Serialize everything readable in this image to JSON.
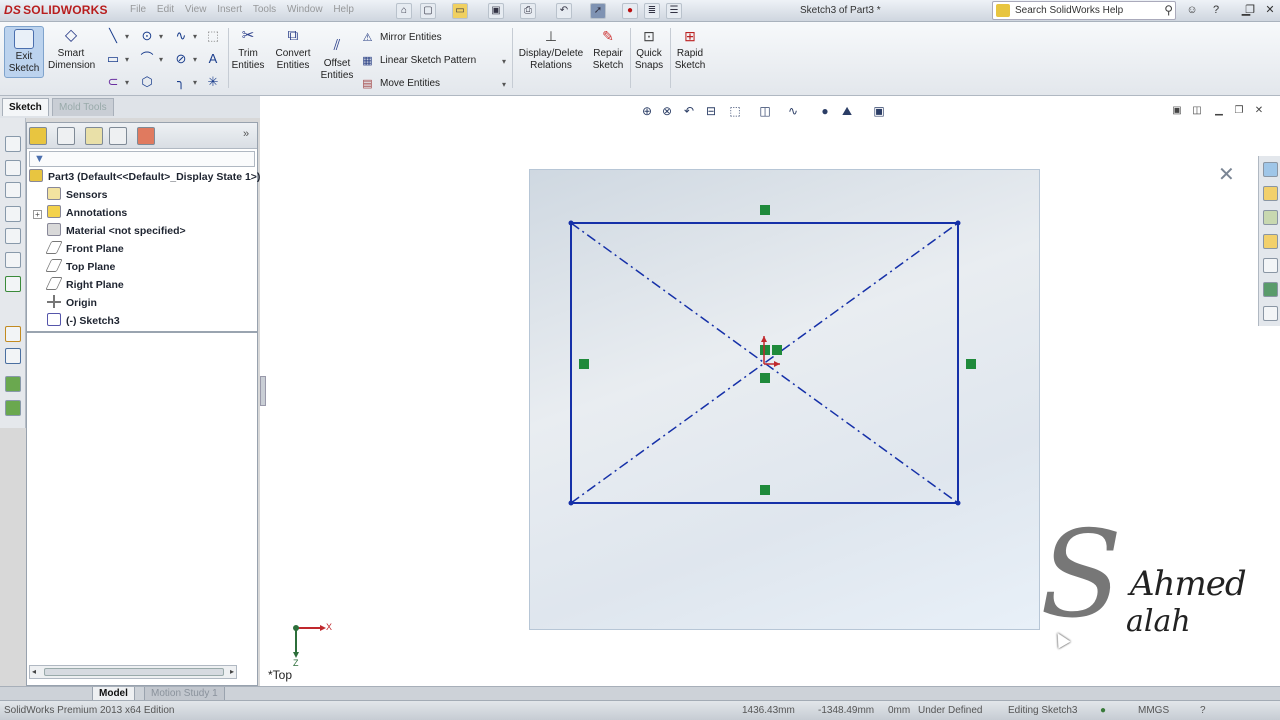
{
  "titlebar": {
    "app_name": "SOLIDWORKS",
    "menu": [
      "File",
      "Edit",
      "View",
      "Insert",
      "Tools",
      "Window",
      "Help"
    ],
    "document_title": "Sketch3 of Part3 *",
    "search_placeholder": "Search SolidWorks Help"
  },
  "ribbon": {
    "exit_sketch": "Exit Sketch",
    "smart_dimension": "Smart Dimension",
    "trim_entities": "Trim Entities",
    "convert_entities": "Convert Entities",
    "offset_entities": "Offset Entities",
    "mirror_entities": "Mirror Entities",
    "linear_sketch_pattern": "Linear Sketch Pattern",
    "move_entities": "Move Entities",
    "display_delete_relations": "Display/Delete Relations",
    "repair_sketch": "Repair Sketch",
    "quick_snaps": "Quick Snaps",
    "rapid_sketch": "Rapid Sketch"
  },
  "command_tabs": [
    "Sketch",
    "Mold Tools"
  ],
  "feature_tree": {
    "root": "Part3  (Default<<Default>_Display State 1>)",
    "items": [
      {
        "label": "Sensors",
        "icon": "sensor-icon"
      },
      {
        "label": "Annotations",
        "icon": "annotations-icon"
      },
      {
        "label": "Material <not specified>",
        "icon": "material-icon"
      },
      {
        "label": "Front Plane",
        "icon": "plane-icon"
      },
      {
        "label": "Top Plane",
        "icon": "plane-icon"
      },
      {
        "label": "Right Plane",
        "icon": "plane-icon"
      },
      {
        "label": "Origin",
        "icon": "origin-icon"
      },
      {
        "label": "(-) Sketch3",
        "icon": "sketch-icon"
      }
    ]
  },
  "viewport": {
    "view_label": "*Top",
    "triad_x": "X",
    "triad_z": "Z"
  },
  "watermark": {
    "first_name": "Ahmed",
    "last_name": "alah",
    "initial": "S"
  },
  "bottom_tabs": [
    "Model",
    "Motion Study 1"
  ],
  "statusbar": {
    "edition": "SolidWorks Premium 2013 x64 Edition",
    "x_coord": "1436.43mm",
    "y_coord": "-1348.49mm",
    "z_coord": "0mm",
    "status": "Under Defined",
    "editing": "Editing Sketch3",
    "units": "MMGS"
  },
  "colors": {
    "sketch_line": "#1530a8",
    "relation_marker": "#1f8a3b",
    "brand_red": "#b81e1e"
  }
}
